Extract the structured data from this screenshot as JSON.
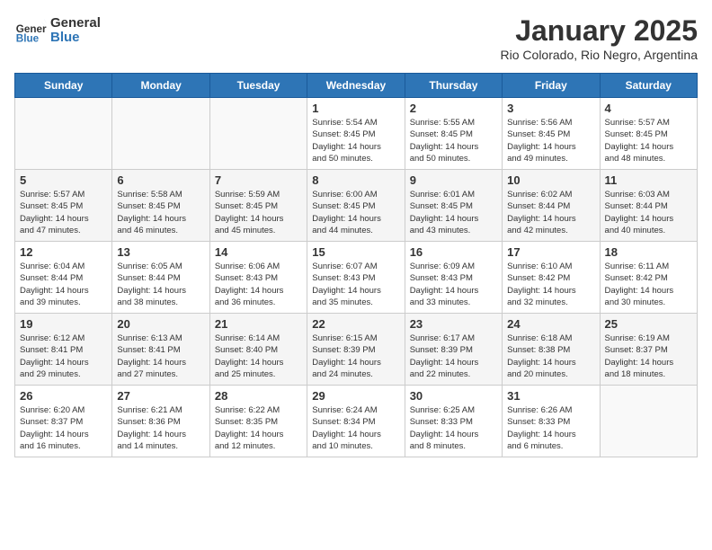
{
  "header": {
    "logo_general": "General",
    "logo_blue": "Blue",
    "title": "January 2025",
    "subtitle": "Rio Colorado, Rio Negro, Argentina"
  },
  "days_of_week": [
    "Sunday",
    "Monday",
    "Tuesday",
    "Wednesday",
    "Thursday",
    "Friday",
    "Saturday"
  ],
  "weeks": [
    [
      {
        "num": "",
        "info": ""
      },
      {
        "num": "",
        "info": ""
      },
      {
        "num": "",
        "info": ""
      },
      {
        "num": "1",
        "info": "Sunrise: 5:54 AM\nSunset: 8:45 PM\nDaylight: 14 hours\nand 50 minutes."
      },
      {
        "num": "2",
        "info": "Sunrise: 5:55 AM\nSunset: 8:45 PM\nDaylight: 14 hours\nand 50 minutes."
      },
      {
        "num": "3",
        "info": "Sunrise: 5:56 AM\nSunset: 8:45 PM\nDaylight: 14 hours\nand 49 minutes."
      },
      {
        "num": "4",
        "info": "Sunrise: 5:57 AM\nSunset: 8:45 PM\nDaylight: 14 hours\nand 48 minutes."
      }
    ],
    [
      {
        "num": "5",
        "info": "Sunrise: 5:57 AM\nSunset: 8:45 PM\nDaylight: 14 hours\nand 47 minutes."
      },
      {
        "num": "6",
        "info": "Sunrise: 5:58 AM\nSunset: 8:45 PM\nDaylight: 14 hours\nand 46 minutes."
      },
      {
        "num": "7",
        "info": "Sunrise: 5:59 AM\nSunset: 8:45 PM\nDaylight: 14 hours\nand 45 minutes."
      },
      {
        "num": "8",
        "info": "Sunrise: 6:00 AM\nSunset: 8:45 PM\nDaylight: 14 hours\nand 44 minutes."
      },
      {
        "num": "9",
        "info": "Sunrise: 6:01 AM\nSunset: 8:45 PM\nDaylight: 14 hours\nand 43 minutes."
      },
      {
        "num": "10",
        "info": "Sunrise: 6:02 AM\nSunset: 8:44 PM\nDaylight: 14 hours\nand 42 minutes."
      },
      {
        "num": "11",
        "info": "Sunrise: 6:03 AM\nSunset: 8:44 PM\nDaylight: 14 hours\nand 40 minutes."
      }
    ],
    [
      {
        "num": "12",
        "info": "Sunrise: 6:04 AM\nSunset: 8:44 PM\nDaylight: 14 hours\nand 39 minutes."
      },
      {
        "num": "13",
        "info": "Sunrise: 6:05 AM\nSunset: 8:44 PM\nDaylight: 14 hours\nand 38 minutes."
      },
      {
        "num": "14",
        "info": "Sunrise: 6:06 AM\nSunset: 8:43 PM\nDaylight: 14 hours\nand 36 minutes."
      },
      {
        "num": "15",
        "info": "Sunrise: 6:07 AM\nSunset: 8:43 PM\nDaylight: 14 hours\nand 35 minutes."
      },
      {
        "num": "16",
        "info": "Sunrise: 6:09 AM\nSunset: 8:43 PM\nDaylight: 14 hours\nand 33 minutes."
      },
      {
        "num": "17",
        "info": "Sunrise: 6:10 AM\nSunset: 8:42 PM\nDaylight: 14 hours\nand 32 minutes."
      },
      {
        "num": "18",
        "info": "Sunrise: 6:11 AM\nSunset: 8:42 PM\nDaylight: 14 hours\nand 30 minutes."
      }
    ],
    [
      {
        "num": "19",
        "info": "Sunrise: 6:12 AM\nSunset: 8:41 PM\nDaylight: 14 hours\nand 29 minutes."
      },
      {
        "num": "20",
        "info": "Sunrise: 6:13 AM\nSunset: 8:41 PM\nDaylight: 14 hours\nand 27 minutes."
      },
      {
        "num": "21",
        "info": "Sunrise: 6:14 AM\nSunset: 8:40 PM\nDaylight: 14 hours\nand 25 minutes."
      },
      {
        "num": "22",
        "info": "Sunrise: 6:15 AM\nSunset: 8:39 PM\nDaylight: 14 hours\nand 24 minutes."
      },
      {
        "num": "23",
        "info": "Sunrise: 6:17 AM\nSunset: 8:39 PM\nDaylight: 14 hours\nand 22 minutes."
      },
      {
        "num": "24",
        "info": "Sunrise: 6:18 AM\nSunset: 8:38 PM\nDaylight: 14 hours\nand 20 minutes."
      },
      {
        "num": "25",
        "info": "Sunrise: 6:19 AM\nSunset: 8:37 PM\nDaylight: 14 hours\nand 18 minutes."
      }
    ],
    [
      {
        "num": "26",
        "info": "Sunrise: 6:20 AM\nSunset: 8:37 PM\nDaylight: 14 hours\nand 16 minutes."
      },
      {
        "num": "27",
        "info": "Sunrise: 6:21 AM\nSunset: 8:36 PM\nDaylight: 14 hours\nand 14 minutes."
      },
      {
        "num": "28",
        "info": "Sunrise: 6:22 AM\nSunset: 8:35 PM\nDaylight: 14 hours\nand 12 minutes."
      },
      {
        "num": "29",
        "info": "Sunrise: 6:24 AM\nSunset: 8:34 PM\nDaylight: 14 hours\nand 10 minutes."
      },
      {
        "num": "30",
        "info": "Sunrise: 6:25 AM\nSunset: 8:33 PM\nDaylight: 14 hours\nand 8 minutes."
      },
      {
        "num": "31",
        "info": "Sunrise: 6:26 AM\nSunset: 8:33 PM\nDaylight: 14 hours\nand 6 minutes."
      },
      {
        "num": "",
        "info": ""
      }
    ]
  ]
}
